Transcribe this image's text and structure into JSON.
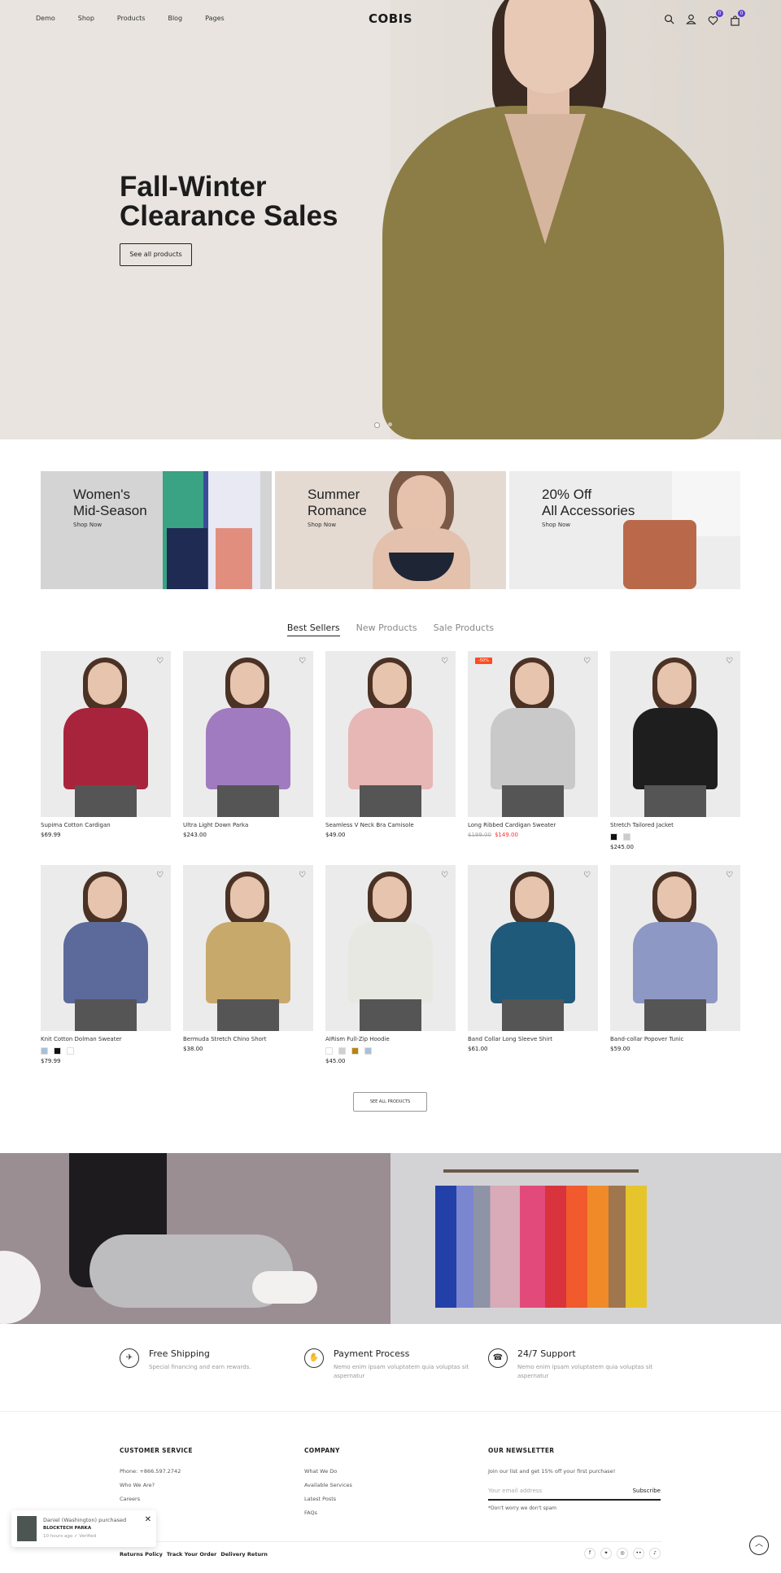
{
  "header": {
    "nav": [
      "Demo",
      "Shop",
      "Products",
      "Blog",
      "Pages"
    ],
    "logo": "COBIS",
    "wishlist_count": "0",
    "cart_count": "0"
  },
  "hero": {
    "title_line1": "Fall-Winter",
    "title_line2": "Clearance Sales",
    "button": "See all products"
  },
  "categories": [
    {
      "title_line1": "Women's",
      "title_line2": "Mid-Season",
      "cta": "Shop Now"
    },
    {
      "title_line1": "Summer",
      "title_line2": "Romance",
      "cta": "Shop Now"
    },
    {
      "title_line1": "20% Off",
      "title_line2": "All Accessories",
      "cta": "Shop Now"
    }
  ],
  "tabs": [
    "Best Sellers",
    "New Products",
    "Sale Products"
  ],
  "products": [
    {
      "name": "Supima Cotton Cardigan",
      "price": "$69.99",
      "color": "#a8243c"
    },
    {
      "name": "Ultra Light Down Parka",
      "price": "$243.00",
      "color": "#a07bbf"
    },
    {
      "name": "Seamless V Neck Bra Camisole",
      "price": "$49.00",
      "color": "#e6b7b4"
    },
    {
      "name": "Long Ribbed Cardigan Sweater",
      "old_price": "$199.00",
      "price": "$149.00",
      "badge": "-50%",
      "color": "#c9c9c9"
    },
    {
      "name": "Stretch Tailored Jacket",
      "price": "$245.00",
      "color": "#1e1e1e",
      "swatches": [
        "#111111",
        "#cccccc"
      ]
    },
    {
      "name": "Knit Cotton Dolman Sweater",
      "price": "$79.99",
      "color": "#5b6a9a",
      "swatches": [
        "#a9c0d8",
        "#111111",
        "#ffffff"
      ]
    },
    {
      "name": "Bermuda Stretch Chino Short",
      "price": "$38.00",
      "color": "#c8a96c"
    },
    {
      "name": "AIRism Full-Zip Hoodie",
      "price": "$45.00",
      "color": "#e8e8e3",
      "swatches": [
        "#ffffff",
        "#cfcfcf",
        "#b8860b",
        "#a9c0d8"
      ]
    },
    {
      "name": "Band Collar Long Sleeve Shirt",
      "price": "$61.00",
      "color": "#1f5a7a"
    },
    {
      "name": "Band-collar Popover Tunic",
      "price": "$59.00",
      "color": "#8e98c4"
    }
  ],
  "see_all": "SEE ALL PRODUCTS",
  "features": [
    {
      "title": "Free Shipping",
      "desc": "Special financing and earn rewards."
    },
    {
      "title": "Payment Process",
      "desc": "Nemo enim ipsam voluptatem quia voluptas sit aspernatur"
    },
    {
      "title": "24/7 Support",
      "desc": "Nemo enim ipsam voluptatem quia voluptas sit aspernatur"
    }
  ],
  "footer": {
    "customer_service": {
      "heading": "CUSTOMER SERVICE",
      "links": [
        "Phone: +866.597.2742",
        "Who We Are?",
        "Careers"
      ]
    },
    "company": {
      "heading": "COMPANY",
      "links": [
        "What We Do",
        "Available Services",
        "Latest Posts",
        "FAQs"
      ]
    },
    "newsletter": {
      "heading": "OUR NEWSLETTER",
      "text": "Join our list and get 15% off your first purchase!",
      "placeholder": "Your email address",
      "button": "Subscribe",
      "note": "*Don't worry we don't spam"
    },
    "bottom_links": [
      "Returns Policy",
      "Track Your Order",
      "Delivery Return"
    ]
  },
  "toast": {
    "line1": "Daniel (Washington) purchased",
    "product": "BLOCKTECH PARKA",
    "time": "10 hours ago",
    "verified": "Verified"
  }
}
